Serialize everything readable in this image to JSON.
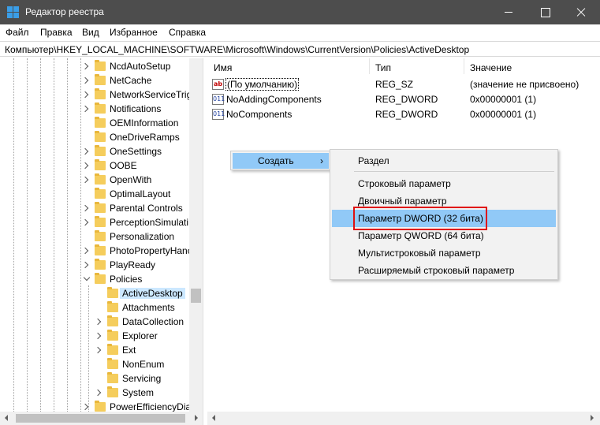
{
  "window": {
    "title": "Редактор реестра"
  },
  "menu": [
    "Файл",
    "Правка",
    "Вид",
    "Избранное",
    "Справка"
  ],
  "address": "Компьютер\\HKEY_LOCAL_MACHINE\\SOFTWARE\\Microsoft\\Windows\\CurrentVersion\\Policies\\ActiveDesktop",
  "tree": {
    "nodes": [
      {
        "label": "NcdAutoSetup",
        "expander": "right",
        "selected": false,
        "level": 1
      },
      {
        "label": "NetCache",
        "expander": "right",
        "selected": false,
        "level": 1
      },
      {
        "label": "NetworkServiceTrig",
        "expander": "right",
        "selected": false,
        "level": 1
      },
      {
        "label": "Notifications",
        "expander": "right",
        "selected": false,
        "level": 1
      },
      {
        "label": "OEMInformation",
        "expander": "none",
        "selected": false,
        "level": 1
      },
      {
        "label": "OneDriveRamps",
        "expander": "none",
        "selected": false,
        "level": 1
      },
      {
        "label": "OneSettings",
        "expander": "right",
        "selected": false,
        "level": 1
      },
      {
        "label": "OOBE",
        "expander": "right",
        "selected": false,
        "level": 1
      },
      {
        "label": "OpenWith",
        "expander": "right",
        "selected": false,
        "level": 1
      },
      {
        "label": "OptimalLayout",
        "expander": "none",
        "selected": false,
        "level": 1
      },
      {
        "label": "Parental Controls",
        "expander": "right",
        "selected": false,
        "level": 1
      },
      {
        "label": "PerceptionSimulati",
        "expander": "right",
        "selected": false,
        "level": 1
      },
      {
        "label": "Personalization",
        "expander": "none",
        "selected": false,
        "level": 1
      },
      {
        "label": "PhotoPropertyHanc",
        "expander": "right",
        "selected": false,
        "level": 1
      },
      {
        "label": "PlayReady",
        "expander": "right",
        "selected": false,
        "level": 1
      },
      {
        "label": "Policies",
        "expander": "down",
        "selected": false,
        "level": 1
      },
      {
        "label": "ActiveDesktop",
        "expander": "none",
        "selected": true,
        "level": 2
      },
      {
        "label": "Attachments",
        "expander": "none",
        "selected": false,
        "level": 2
      },
      {
        "label": "DataCollection",
        "expander": "right",
        "selected": false,
        "level": 2
      },
      {
        "label": "Explorer",
        "expander": "right",
        "selected": false,
        "level": 2
      },
      {
        "label": "Ext",
        "expander": "right",
        "selected": false,
        "level": 2
      },
      {
        "label": "NonEnum",
        "expander": "none",
        "selected": false,
        "level": 2
      },
      {
        "label": "Servicing",
        "expander": "none",
        "selected": false,
        "level": 2
      },
      {
        "label": "System",
        "expander": "right",
        "selected": false,
        "level": 2
      },
      {
        "label": "PowerEfficiencyDia",
        "expander": "right",
        "selected": false,
        "level": 1
      }
    ]
  },
  "list": {
    "columns": {
      "name": "Имя",
      "type": "Тип",
      "value": "Значение"
    },
    "rows": [
      {
        "icon": "string-value-icon",
        "icon_text": "ab",
        "name": "(По умолчанию)",
        "type": "REG_SZ",
        "value": "(значение не присвоено)"
      },
      {
        "icon": "binary-value-icon",
        "icon_text": "011",
        "name": "NoAddingComponents",
        "type": "REG_DWORD",
        "value": "0x00000001 (1)"
      },
      {
        "icon": "binary-value-icon",
        "icon_text": "011",
        "name": "NoComponents",
        "type": "REG_DWORD",
        "value": "0x00000001 (1)"
      }
    ]
  },
  "context_menu": {
    "label": "Создать",
    "arrow": "›"
  },
  "sub_menu": {
    "items": [
      "Раздел",
      "Строковый параметр",
      "Двоичный параметр",
      "Параметр DWORD (32 бита)",
      "Параметр QWORD (64 бита)",
      "Мультистроковый параметр",
      "Расширяемый строковый параметр"
    ],
    "highlighted": "Параметр DWORD (32 бита)"
  },
  "colors": {
    "titlebar": "#4d4d4d",
    "menu_highlight": "#91c9f7",
    "tree_selection": "#cce8ff",
    "annotation_box": "#e01010"
  }
}
